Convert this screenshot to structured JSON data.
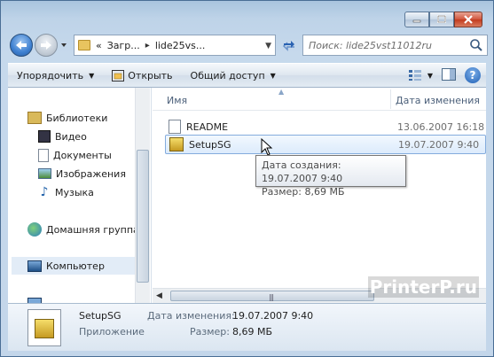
{
  "window": {
    "caption_buttons": [
      "minimize",
      "maximize",
      "close"
    ]
  },
  "address": {
    "crumb_overflow": "«",
    "crumb1": "Загр...",
    "crumb2": "lide25vs...",
    "separator": "▸"
  },
  "search": {
    "placeholder": "Поиск: lide25vst11012ru"
  },
  "toolbar": {
    "organize": "Упорядочить",
    "open": "Открыть",
    "share": "Общий доступ"
  },
  "nav_pane": {
    "items": [
      {
        "label": "Библиотеки",
        "icon": "library-icon"
      },
      {
        "label": "Видео",
        "icon": "video-icon"
      },
      {
        "label": "Документы",
        "icon": "documents-icon"
      },
      {
        "label": "Изображения",
        "icon": "images-icon"
      },
      {
        "label": "Музыка",
        "icon": "music-icon"
      },
      {
        "label": "Домашняя группа",
        "icon": "homegroup-icon"
      },
      {
        "label": "Компьютер",
        "icon": "computer-icon"
      }
    ]
  },
  "file_list": {
    "columns": {
      "name": "Имя",
      "date": "Дата изменения"
    },
    "rows": [
      {
        "name": "README",
        "date": "13.06.2007 16:18",
        "icon": "text-file-icon"
      },
      {
        "name": "SetupSG",
        "date": "19.07.2007 9:40",
        "icon": "setup-exe-icon"
      }
    ]
  },
  "tooltip": {
    "created": "Дата создания: 19.07.2007 9:40",
    "size": "Размер: 8,69 МБ"
  },
  "details": {
    "name": "SetupSG",
    "type": "Приложение",
    "date_label": "Дата изменения:",
    "date_value": "19.07.2007 9:40",
    "size_label": "Размер:",
    "size_value": "8,69 МБ"
  },
  "watermark": "PrinterP.ru"
}
